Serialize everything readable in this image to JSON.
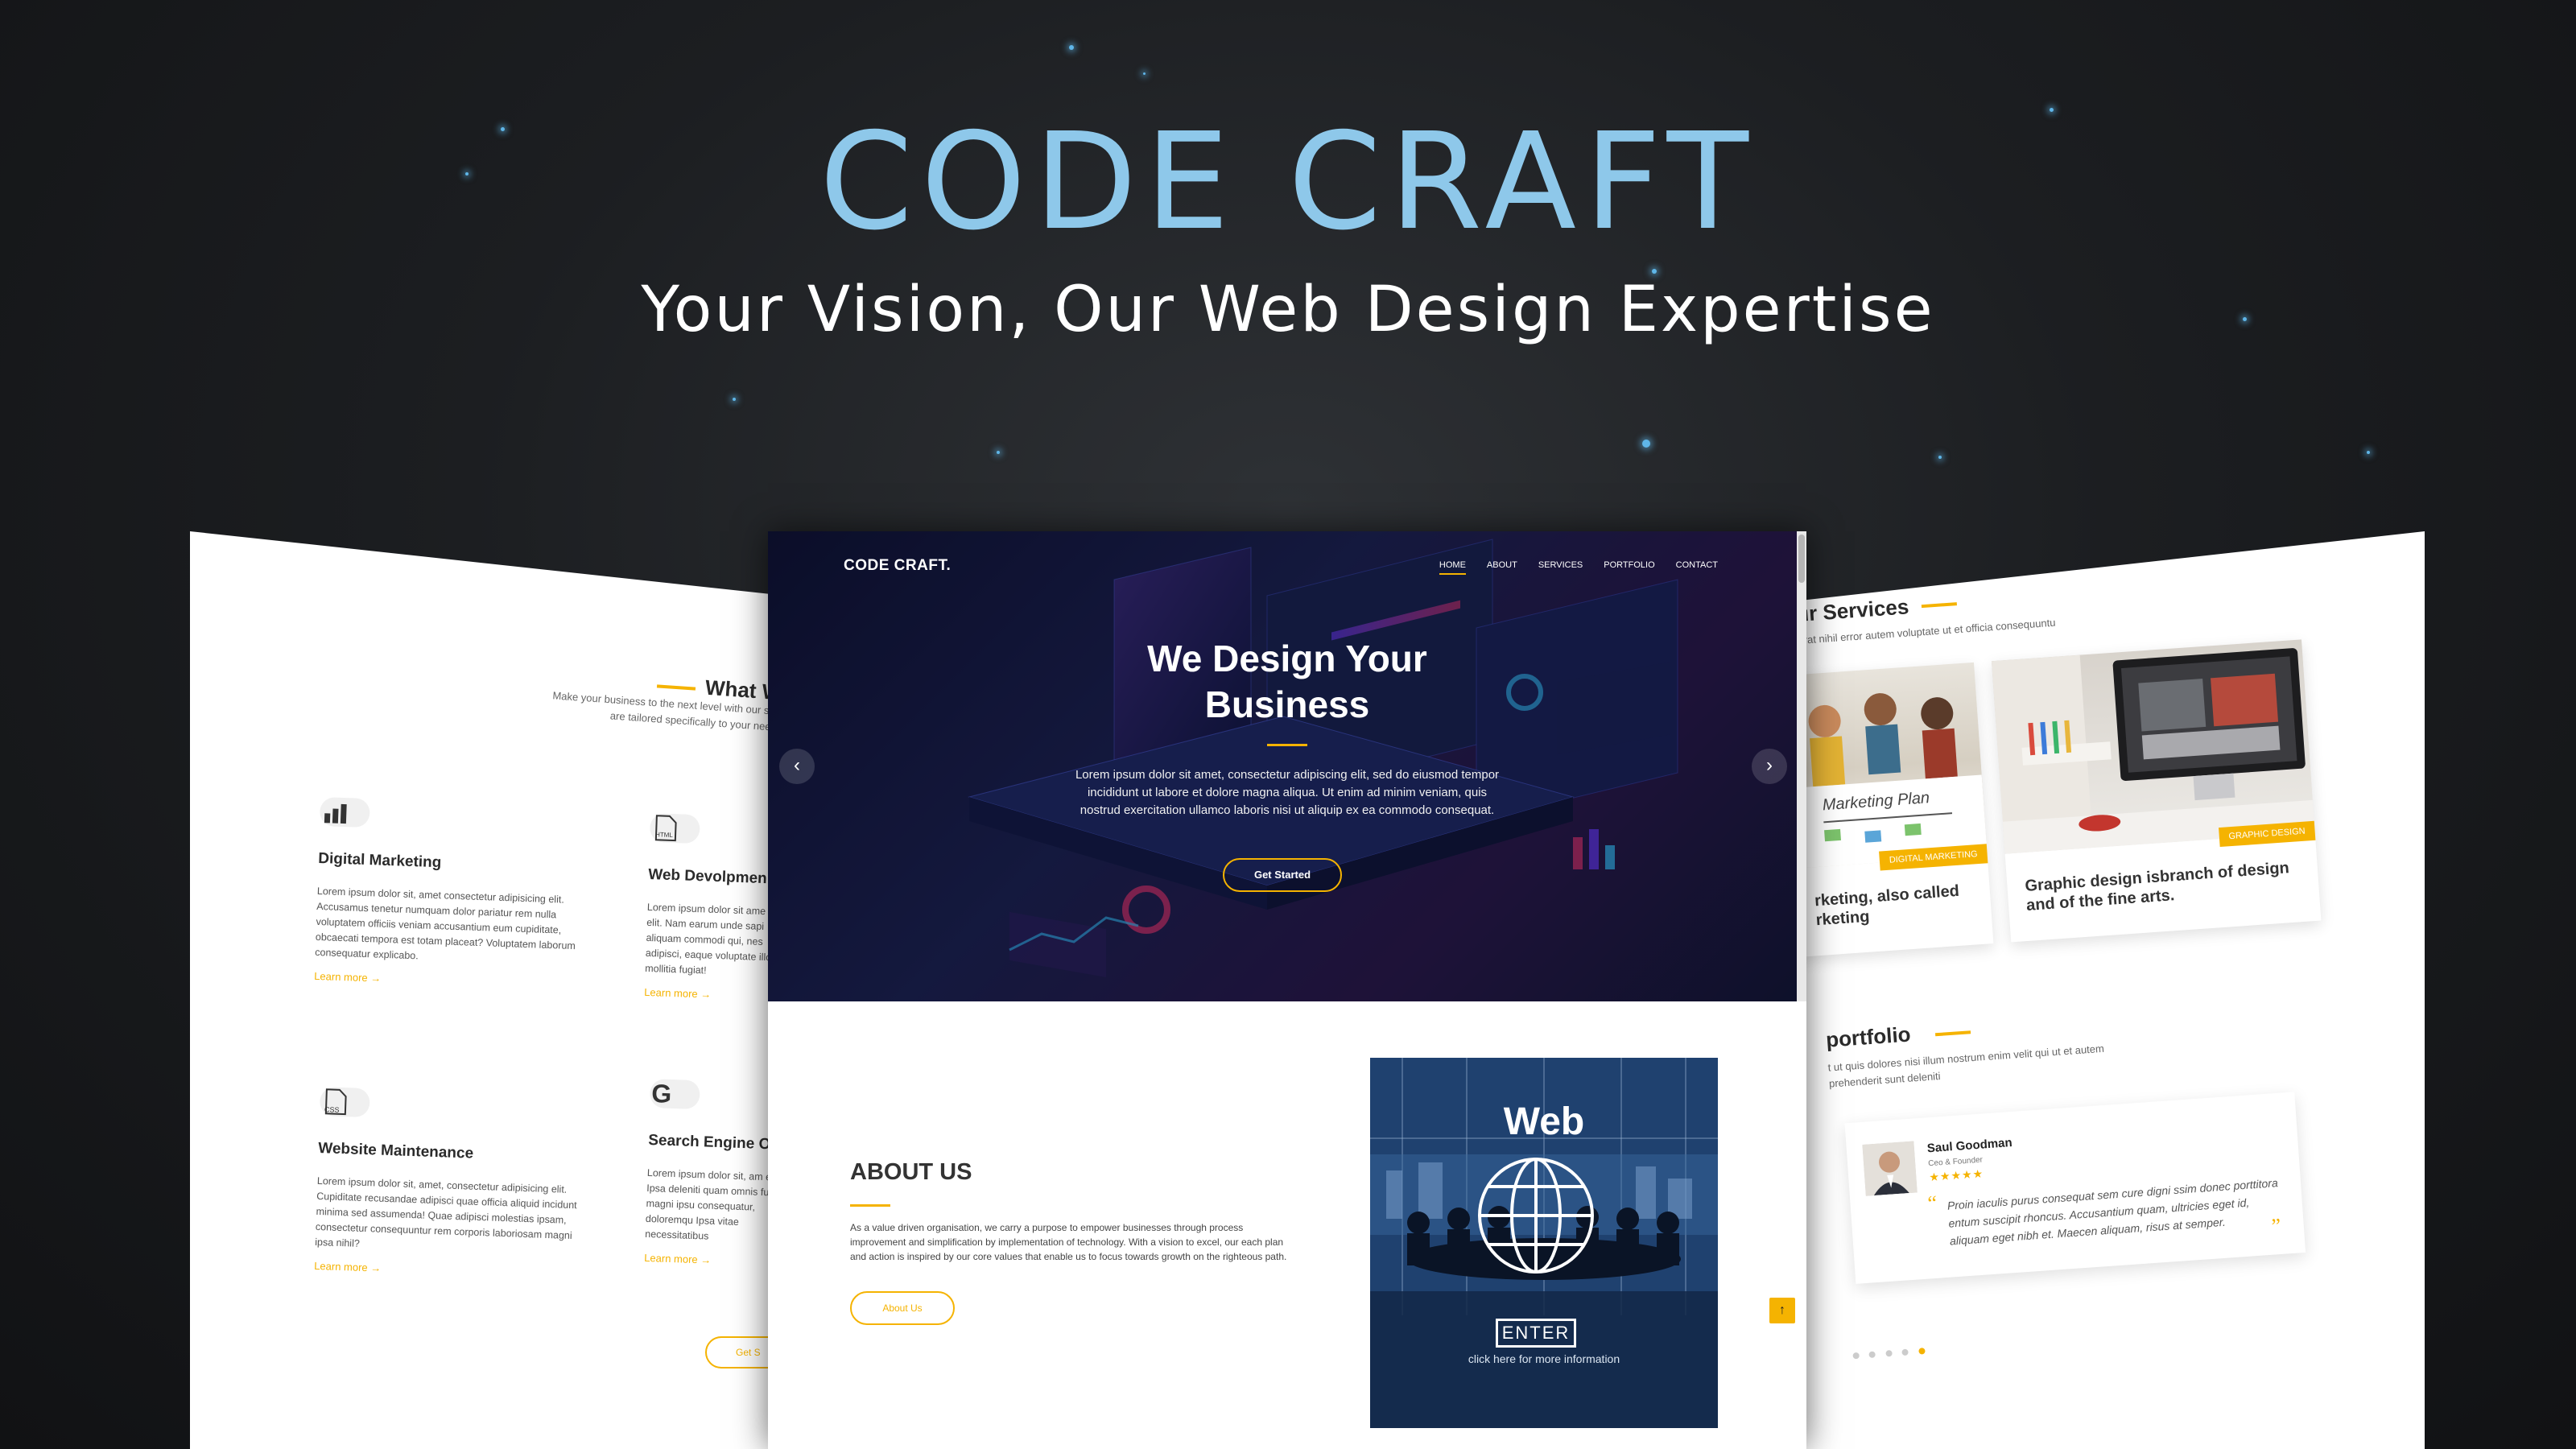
{
  "hero": {
    "title": "CODE CRAFT",
    "tagline": "Your Vision, Our Web Design Expertise"
  },
  "colors": {
    "accent": "#f5b301",
    "title": "#8ec8ea",
    "background": "#1c1e21"
  },
  "left_page": {
    "heading": "What W",
    "subtitle_line1": "Make your business to the next level with our servi",
    "subtitle_line2": "are tailored specifically to your needs.",
    "services": [
      {
        "icon": "bar-chart-icon",
        "title": "Digital Marketing",
        "text": "Lorem ipsum dolor sit, amet consectetur adipisicing elit. Accusamus tenetur numquam dolor pariatur rem nulla voluptatem officiis veniam accusantium eum cupiditate, obcaecati tempora est totam placeat? Voluptatem laborum consequatur explicabo.",
        "link": "Learn more →"
      },
      {
        "icon": "html-file-icon",
        "title": "Web Devolpmen",
        "text": "Lorem ipsum dolor sit ame elit. Nam earum unde sapi aliquam commodi qui, nes adipisci, eaque voluptate illo mollitia fugiat!",
        "link": "Learn more →"
      },
      {
        "icon": "css-file-icon",
        "title": "Website Maintenance",
        "text": "Lorem ipsum dolor sit, amet, consectetur adipisicing elit. Cupiditate recusandae adipisci quae officia aliquid incidunt minima sed assumenda! Quae adipisci molestias ipsam, consectetur consequuntur rem corporis laboriosam magni ipsa nihil?",
        "link": "Learn more →"
      },
      {
        "icon": "google-icon",
        "title": "Search Engine Op",
        "text": "Lorem ipsum dolor sit, am elit. Ipsa deleniti quam omnis fuga, magni ipsu consequatur, doloremqu Ipsa vitae necessitatibus",
        "link": "Learn more →"
      }
    ],
    "button": "Get S"
  },
  "center_page": {
    "logo": "CODE CRAFT.",
    "nav": [
      "HOME",
      "ABOUT",
      "SERVICES",
      "PORTFOLIO",
      "CONTACT"
    ],
    "nav_active": "HOME",
    "headline_line1": "We Design Your",
    "headline_line2": "Business",
    "body": "Lorem ipsum dolor sit amet, consectetur adipiscing elit, sed do eiusmod tempor incididunt ut labore et dolore magna aliqua. Ut enim ad minim veniam, quis nostrud exercitation ullamco laboris nisi ut aliquip ex ea commodo consequat.",
    "cta": "Get Started",
    "prev_arrow": "‹",
    "next_arrow": "›",
    "about": {
      "title": "ABOUT US",
      "text": "As a value driven organisation, we carry a purpose to empower businesses through process improvement and simplification by implementation of technology. With a vision to excel, our each plan and action is inspired by our core values that enable us to focus towards growth on the righteous path.",
      "button": "About Us"
    },
    "web_card": {
      "title": "Web",
      "enter": "ENTER",
      "caption": "click here for more information"
    },
    "scroll_top": "↑"
  },
  "right_page": {
    "heading": "ur Services",
    "subtitle": "erat nihil error autem voluptate ut et officia consequuntu",
    "cards": [
      {
        "badge": "DIGITAL MARKETING",
        "board_text": "Marketing Plan",
        "text": "rketing, also called rketing"
      },
      {
        "badge": "GRAPHIC DESIGN",
        "text": "Graphic design isbranch of design and of the fine arts."
      }
    ],
    "portfolio_heading": "portfolio",
    "portfolio_sub_line1": "t ut quis dolores nisi illum nostrum enim velit qui ut et autem",
    "portfolio_sub_line2": "prehenderit sunt deleniti",
    "testimonial": {
      "name": "Saul Goodman",
      "role": "Ceo & Founder",
      "stars": "★★★★★",
      "quote": "Proin iaculis purus consequat sem cure digni ssim donec porttitora entum suscipit rhoncus. Accusantium quam, ultricies eget id, aliquam eget nibh et. Maecen aliquam, risus at semper.",
      "open_quote": "“",
      "close_quote": "”"
    },
    "dots_total": 5,
    "dots_active": 5
  }
}
